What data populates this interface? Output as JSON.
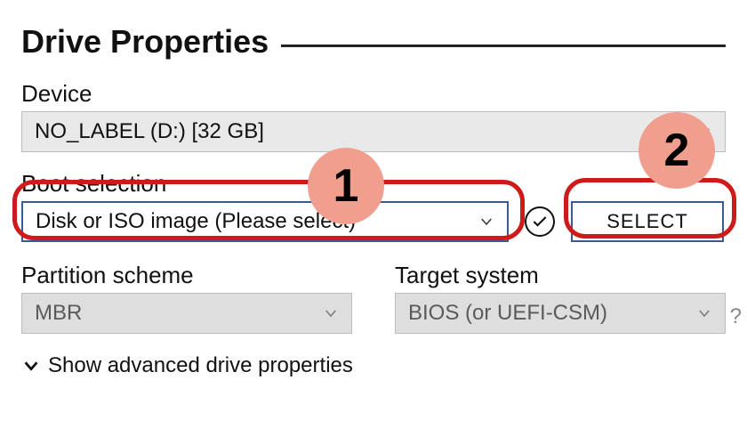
{
  "section_title": "Drive Properties",
  "device": {
    "label": "Device",
    "value": "NO_LABEL (D:) [32 GB]"
  },
  "boot_selection": {
    "label": "Boot selection",
    "value": "Disk or ISO image (Please select)"
  },
  "select_button": "SELECT",
  "partition_scheme": {
    "label": "Partition scheme",
    "value": "MBR"
  },
  "target_system": {
    "label": "Target system",
    "value": "BIOS (or UEFI-CSM)"
  },
  "advanced_toggle": "Show advanced drive properties",
  "help_hint": "?",
  "annotations": {
    "badge1": "1",
    "badge2": "2"
  }
}
